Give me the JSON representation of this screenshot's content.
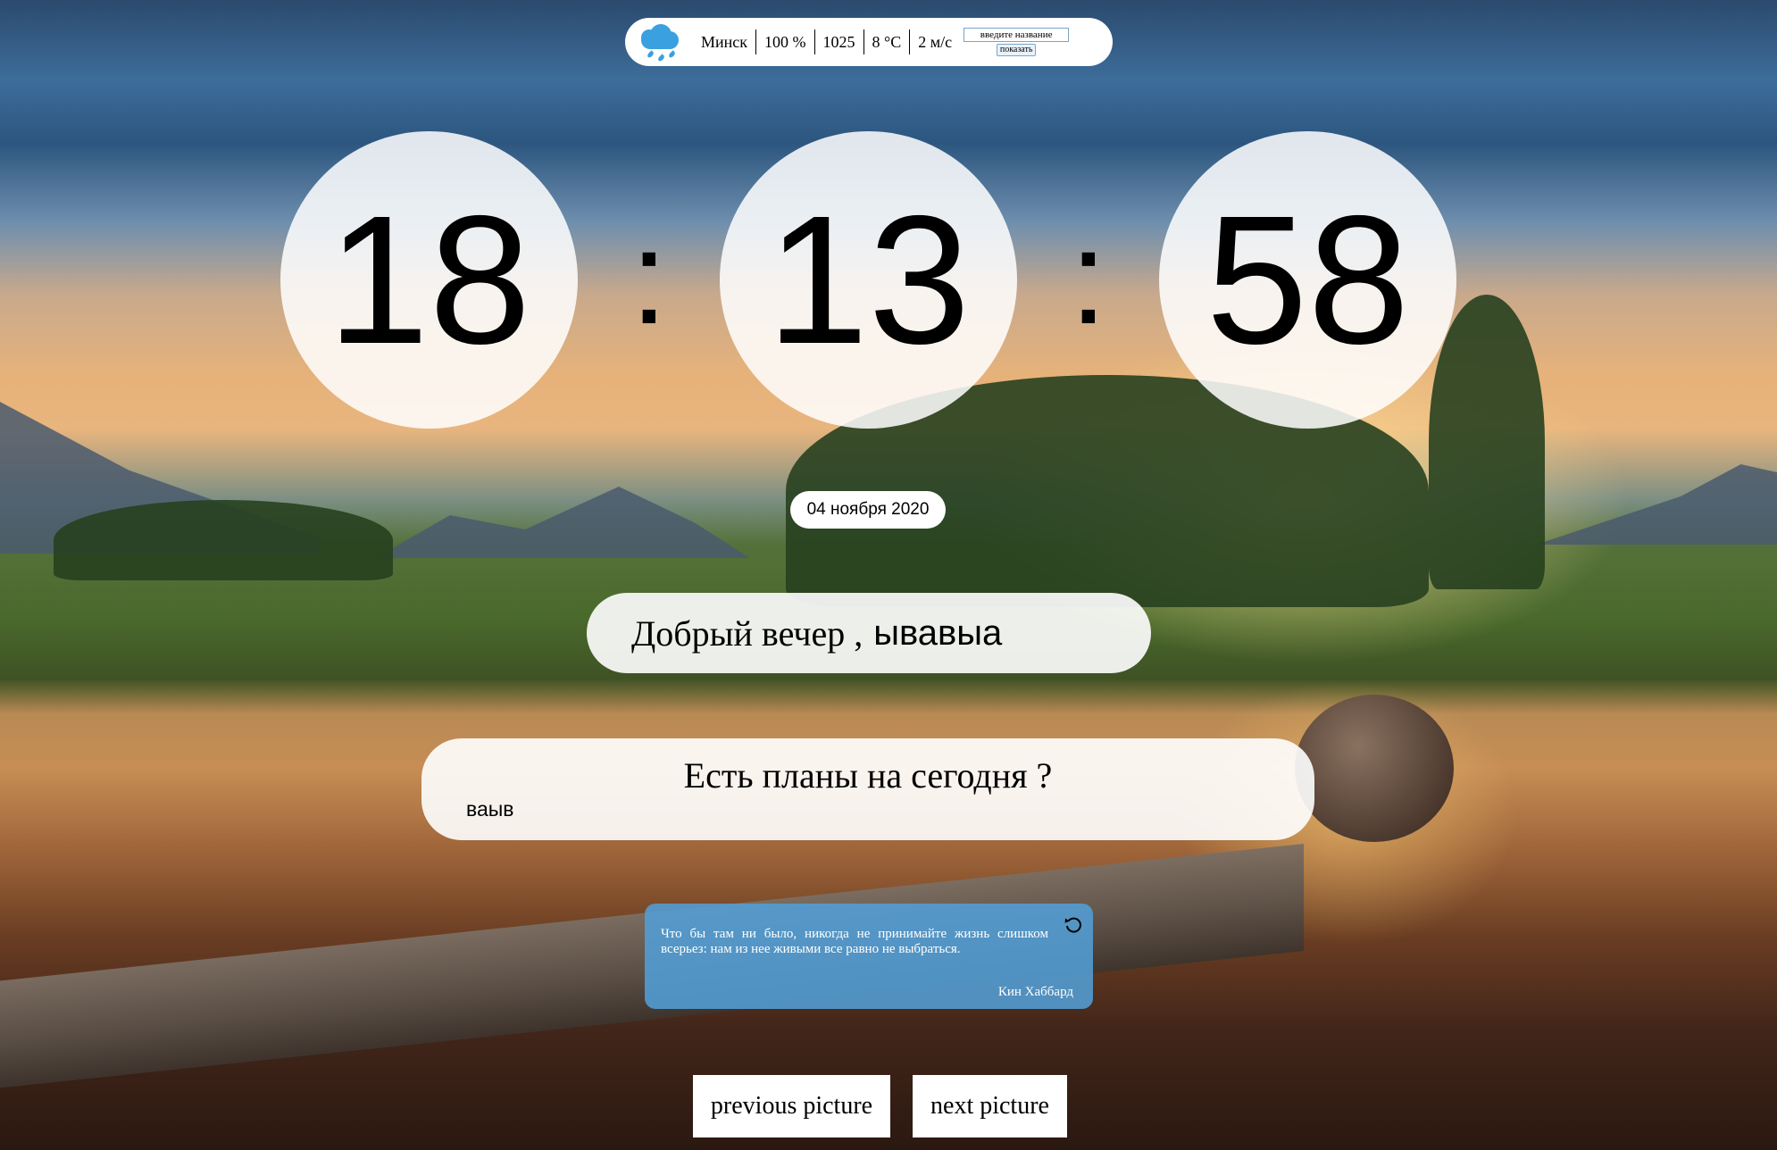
{
  "weather": {
    "icon": "rain-cloud-icon",
    "city": "Минск",
    "humidity": "100 %",
    "pressure": "1025",
    "temperature": "8 °C",
    "wind": "2 м/с",
    "city_input_placeholder": "введите название",
    "show_button_label": "показать"
  },
  "clock": {
    "hours": "18",
    "minutes": "13",
    "seconds": "58",
    "separator": ":"
  },
  "date": "04 ноября 2020",
  "greeting": {
    "text": "Добрый вечер ,",
    "name": "ывавыа"
  },
  "plans": {
    "question": "Есть планы на сегодня ?",
    "answer": "ваыв"
  },
  "quote": {
    "text": "Что бы там ни было, никогда не принимайте жизнь слишком всерьез: нам из нее живыми все равно не выбраться.",
    "author": "Кин Хаббард",
    "refresh_icon": "refresh-icon"
  },
  "navigation": {
    "previous_label": "previous picture",
    "next_label": "next picture"
  },
  "colors": {
    "weather_icon": "#3aa0e0",
    "quote_background": "#529ed6"
  }
}
